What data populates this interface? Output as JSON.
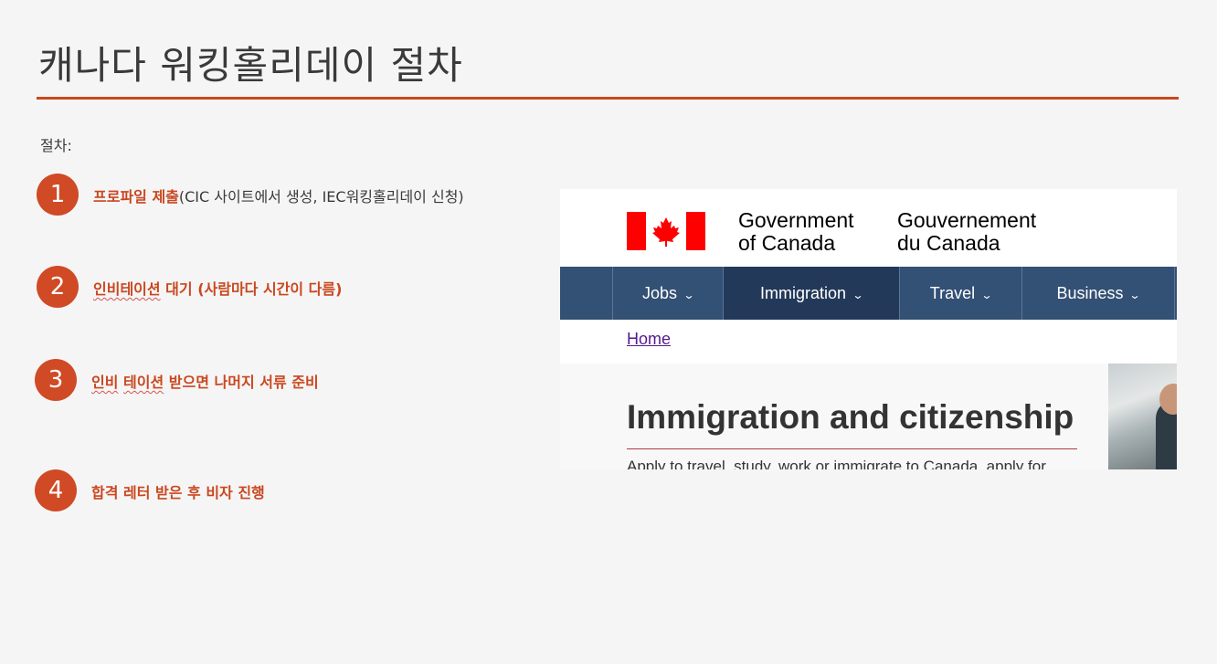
{
  "title": "캐나다 워킹홀리데이 절차",
  "intro": "절차:",
  "steps": [
    {
      "num": "1",
      "accent": "프로파일 제출",
      "rest": "(CIC 사이트에서 생성, IEC워킹홀리데이 신청)"
    },
    {
      "num": "2",
      "accent_a": "인비테이션",
      "accent_b": " 대기 (사람마다 시간이 다름)"
    },
    {
      "num": "3",
      "accent_a": "인비",
      "accent_gap": " ",
      "accent_b": "테이션",
      "accent_c": " 받으면 나머지 서류 준비"
    },
    {
      "num": "4",
      "accent": "합격 레터 받은 후 비자 진행"
    }
  ],
  "website": {
    "gov_en": [
      "Government",
      "of Canada"
    ],
    "gov_fr": [
      "Gouvernement",
      "du Canada"
    ],
    "nav": [
      "Jobs",
      "Immigration",
      "Travel",
      "Business"
    ],
    "breadcrumb": "Home",
    "heading": "Immigration and citizenship",
    "subtext": "Apply to travel, study, work or immigrate to Canada, apply for",
    "colors": {
      "nav_bg": "#335075",
      "nav_active": "#23395a",
      "flag_red": "#ff0000"
    }
  },
  "colors": {
    "accent": "#c9471f",
    "circle": "#d04a25",
    "background": "#f5f5f5"
  }
}
